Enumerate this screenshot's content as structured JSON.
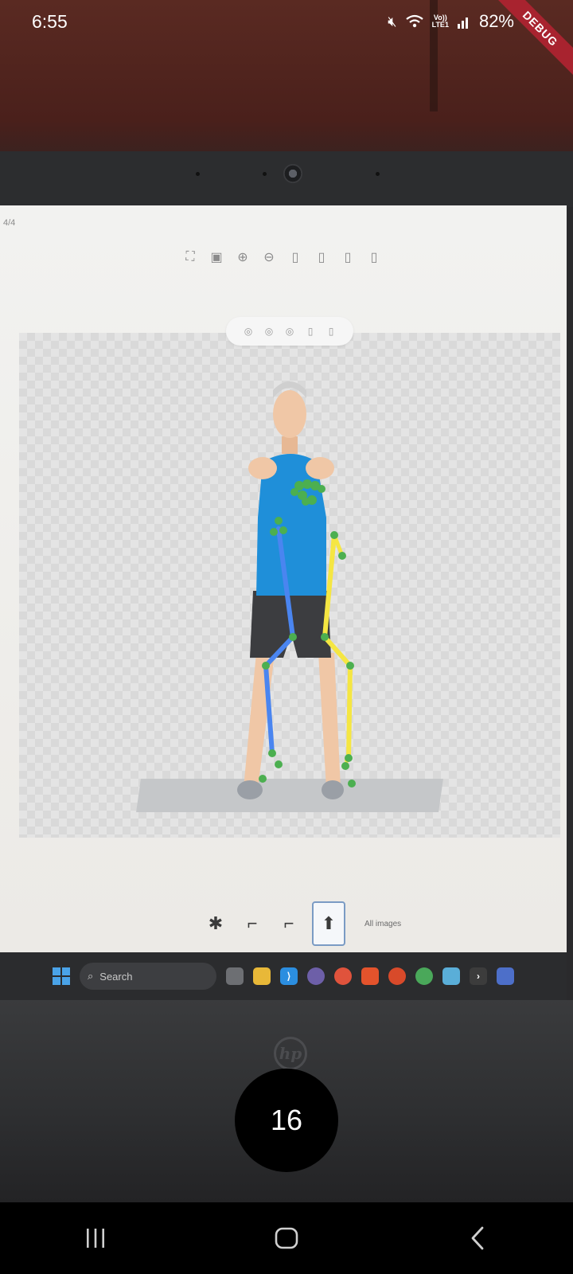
{
  "status_bar": {
    "time": "6:55",
    "volte_line1": "Vo))",
    "volte_line2": "LTE1",
    "battery": "82%",
    "debug_banner": "DEBUG"
  },
  "laptop": {
    "page_indicator": "4/4",
    "thumbnails_label": "All images",
    "taskbar_search": "Search",
    "brand": "hp"
  },
  "counter": {
    "value": "16"
  },
  "pose_colors": {
    "left_limb": "#4a85f0",
    "right_limb": "#f5e642",
    "keypoint": "#4caf50"
  }
}
